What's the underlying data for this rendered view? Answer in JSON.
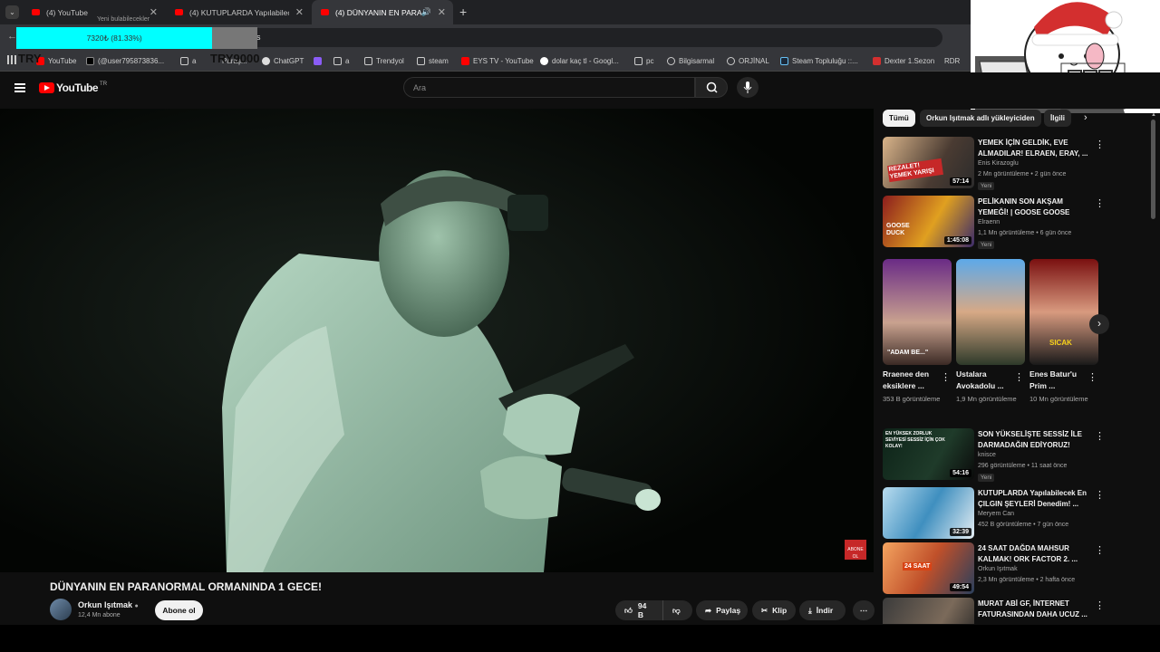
{
  "browser": {
    "tabs": [
      {
        "label": "(4) YouTube"
      },
      {
        "label": "(4) KUTUPLARDA Yapılabilecek"
      },
      {
        "label": "(4) DÜNYANIN EN PARANO"
      }
    ],
    "new_tab": "+",
    "tab_close": "✕",
    "tiny_label": "Yeni bulabilecekler",
    "url_tail": "s",
    "bookmarks": [
      {
        "label": "YouTube"
      },
      {
        "label": "(@user795873836..."
      },
      {
        "label": "a"
      },
      {
        "label": "Paraş..."
      },
      {
        "label": "ChatGPT"
      },
      {
        "label": "a"
      },
      {
        "label": "Trendyol"
      },
      {
        "label": "steam"
      },
      {
        "label": "EYS TV - YouTube"
      },
      {
        "label": "dolar kaç tl - Googl..."
      },
      {
        "label": "pc"
      },
      {
        "label": "Bilgisarmal"
      },
      {
        "label": "ORJİNAL"
      },
      {
        "label": "Steam Topluluğu ::..."
      },
      {
        "label": "Dexter 1.Sezon"
      },
      {
        "label": "RDR"
      }
    ]
  },
  "overlay": {
    "progress_text": "7320₺ (81.33%)",
    "progress_fraction": 0.8133,
    "try_left": "TRY",
    "try_right": "TRY9000",
    "colors": {
      "progress": "#00ffff"
    }
  },
  "youtube": {
    "logo": "YouTube",
    "region": "TR",
    "search_placeholder": "Ara",
    "video": {
      "title": "DÜNYANIN EN PARANORMAL ORMANINDA 1 GECE!",
      "channel": "Orkun Işıtmak",
      "subscribers": "12,4 Mn abone",
      "subscribe": "Abone ol",
      "likes": "94 B",
      "share": "Paylaş",
      "clip": "Klip",
      "download": "İndir",
      "watermark": "ABONE OL"
    },
    "chips": [
      "Tümü",
      "Orkun Işıtmak adlı yükleyiciden",
      "İlgili"
    ],
    "recommendations_top": [
      {
        "title": "YEMEK İÇİN GELDİK, EVE ALMADILAR! ELRAEN, ERAY, ...",
        "channel": "Enis Kirazoglu",
        "meta": "2 Mn görüntüleme • 2 gün önce",
        "badge": "Yeni",
        "duration": "57:14",
        "thumb_text": "REZALET! YEMEK YARIŞI"
      },
      {
        "title": "PELİKANIN SON AKŞAM YEMEĞİ! | GOOSE GOOSE DUC...",
        "channel": "Elraenn",
        "meta": "1,1 Mn görüntüleme • 6 gün önce",
        "badge": "Yeni",
        "duration": "1:45:08",
        "thumb_text": "GOOSE DUCK"
      }
    ],
    "shorts": [
      {
        "title": "Rraenee den eksiklere ...",
        "views": "353 B görüntüleme",
        "overlay": "\"ADAM BE...\""
      },
      {
        "title": "Ustalara Avokadolu ...",
        "views": "1,9 Mn görüntüleme",
        "overlay": ""
      },
      {
        "title": "Enes Batur'u Prim ...",
        "views": "10 Mn görüntüleme",
        "overlay": "SICAK"
      }
    ],
    "recommendations_bottom": [
      {
        "title": "SON YÜKSELİŞTE SESSİZ İLE DARMADAĞIN EDİYORUZ! (Sla...",
        "channel": "knisce",
        "meta": "296 görüntüleme • 11 saat önce",
        "badge": "Yeni",
        "duration": "54:16",
        "thumb_text": "EN YÜKSEK ZORLUK SEVİYESİ SESSİZ İÇİN ÇOK KOLAY!"
      },
      {
        "title": "KUTUPLARDA Yapılabilecek En ÇILGIN ŞEYLERİ Denedim! ...",
        "channel": "Meryem Can",
        "meta": "452 B görüntüleme • 7 gün önce",
        "badge": "",
        "duration": "32:39",
        "thumb_text": ""
      },
      {
        "title": "24 SAAT DAĞDA MAHSUR KALMAK! ORK FACTOR 2. ...",
        "channel": "Orkun Işıtmak",
        "meta": "2,3 Mn görüntüleme • 2 hafta önce",
        "badge": "",
        "duration": "49:54",
        "thumb_text": "24 SAAT"
      },
      {
        "title": "MURAT ABİ GF, İNTERNET FATURASINDAN DAHA UCUZ ...",
        "channel": "",
        "meta": "",
        "badge": "",
        "duration": "",
        "thumb_text": ""
      }
    ]
  }
}
